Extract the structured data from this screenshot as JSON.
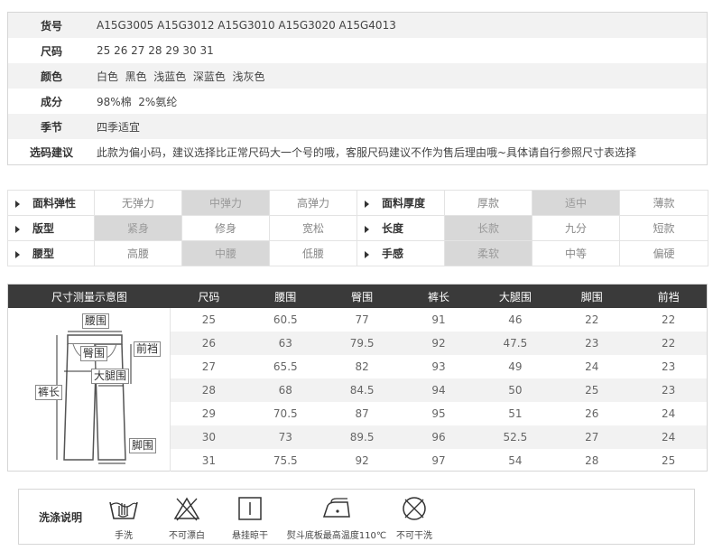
{
  "info": [
    {
      "label": "货号",
      "value": "A15G3005 A15G3012 A15G3010 A15G3020 A15G4013"
    },
    {
      "label": "尺码",
      "value": "25 26 27 28 29 30 31"
    },
    {
      "label": "颜色",
      "value": "白色  黑色  浅蓝色  深蓝色  浅灰色"
    },
    {
      "label": "成分",
      "value": "98%棉  2%氨纶"
    },
    {
      "label": "季节",
      "value": "四季适宜"
    },
    {
      "label": "选码建议",
      "value": "此款为偏小码，建议选择比正常尺码大一个号的哦，客服尺码建议不作为售后理由哦~具体请自行参照尺寸表选择"
    }
  ],
  "attributes": [
    {
      "left": {
        "label": "面料弹性",
        "options": [
          "无弹力",
          "中弹力",
          "高弹力"
        ],
        "selected": 1
      },
      "right": {
        "label": "面料厚度",
        "options": [
          "厚款",
          "适中",
          "薄款"
        ],
        "selected": 1
      }
    },
    {
      "left": {
        "label": "版型",
        "options": [
          "紧身",
          "修身",
          "宽松"
        ],
        "selected": 0
      },
      "right": {
        "label": "长度",
        "options": [
          "长款",
          "九分",
          "短款"
        ],
        "selected": 0
      }
    },
    {
      "left": {
        "label": "腰型",
        "options": [
          "高腰",
          "中腰",
          "低腰"
        ],
        "selected": 1
      },
      "right": {
        "label": "手感",
        "options": [
          "柔软",
          "中等",
          "偏硬"
        ],
        "selected": 0
      }
    }
  ],
  "size_chart": {
    "diagram_header": "尺寸测量示意图",
    "columns": [
      "尺码",
      "腰围",
      "臀围",
      "裤长",
      "大腿围",
      "脚围",
      "前裆"
    ],
    "rows": [
      [
        "25",
        "60.5",
        "77",
        "91",
        "46",
        "22",
        "22"
      ],
      [
        "26",
        "63",
        "79.5",
        "92",
        "47.5",
        "23",
        "22"
      ],
      [
        "27",
        "65.5",
        "82",
        "93",
        "49",
        "24",
        "23"
      ],
      [
        "28",
        "68",
        "84.5",
        "94",
        "50",
        "25",
        "23"
      ],
      [
        "29",
        "70.5",
        "87",
        "95",
        "51",
        "26",
        "24"
      ],
      [
        "30",
        "73",
        "89.5",
        "96",
        "52.5",
        "27",
        "24"
      ],
      [
        "31",
        "75.5",
        "92",
        "97",
        "54",
        "28",
        "25"
      ]
    ],
    "diagram_labels": {
      "waist": "腰围",
      "hip": "臀围",
      "rise": "前裆",
      "thigh": "大腿围",
      "length": "裤长",
      "hem": "脚围"
    }
  },
  "washing": {
    "title": "洗涤说明",
    "items": [
      {
        "icon": "hand-wash-icon",
        "label": "手洗"
      },
      {
        "icon": "no-bleach-icon",
        "label": "不可漂白"
      },
      {
        "icon": "hang-dry-icon",
        "label": "悬挂晾干"
      },
      {
        "icon": "iron-icon",
        "label": "熨斗底板最高温度110℃"
      },
      {
        "icon": "no-dry-clean-icon",
        "label": "不可干洗"
      }
    ]
  }
}
